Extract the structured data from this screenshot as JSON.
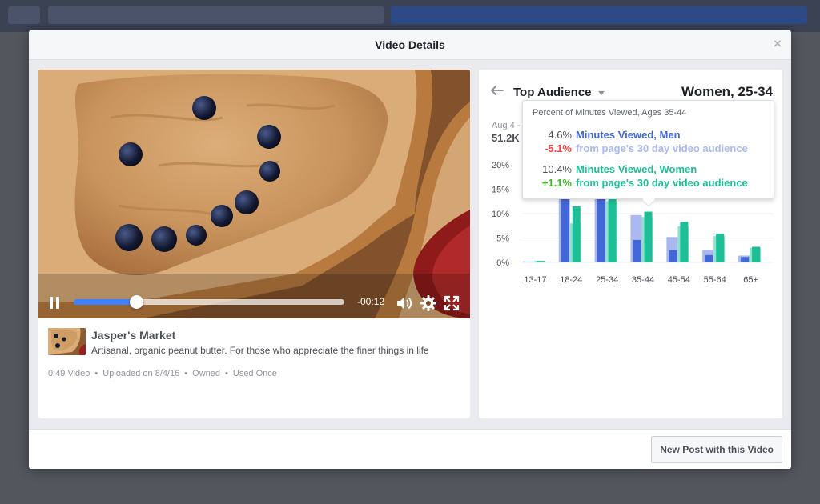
{
  "modal": {
    "title": "Video Details",
    "close_glyph": "×",
    "cta_label": "New Post with this Video"
  },
  "player": {
    "time_remaining": "-00:12",
    "progress": 0.23
  },
  "video_info": {
    "page_name": "Jasper's Market",
    "description": "Artisanal, organic peanut butter. For those who appreciate the finer things in life",
    "facts": [
      "0:49 Video",
      "Uploaded on 8/4/16",
      "Owned",
      "Used Once"
    ]
  },
  "audience": {
    "title": "Top Audience",
    "segment": "Women, 25-34",
    "date_label": "Aug 4 -",
    "big_number": "51.2K"
  },
  "tooltip": {
    "heading": "Percent of Minutes Viewed, Ages 35-44",
    "men_value": "4.6%",
    "men_label": "Minutes Viewed, Men",
    "men_delta": "-5.1%",
    "men_delta_label": "from page's 30 day video audience",
    "women_value": "10.4%",
    "women_label": "Minutes Viewed, Women",
    "women_delta": "+1.1%",
    "women_delta_label": "from page's 30 day video audience"
  },
  "colors": {
    "men": "#4267d6",
    "men_baseline": "#aab8ef",
    "women": "#1dbf97",
    "women_baseline": "#8fe3cb",
    "negative": "#fa3e3e",
    "positive": "#42b72a",
    "accent": "#4080ff"
  },
  "chart_data": {
    "type": "bar",
    "categories": [
      "13-17",
      "18-24",
      "25-34",
      "35-44",
      "45-54",
      "55-64",
      "65+"
    ],
    "series": [
      {
        "name": "Minutes Viewed, Men",
        "values": [
          0.1,
          14.5,
          14.0,
          4.6,
          2.5,
          1.5,
          1.1
        ]
      },
      {
        "name": "Minutes Viewed, Women",
        "values": [
          0.3,
          11.5,
          15.0,
          10.4,
          8.3,
          5.9,
          3.2
        ]
      }
    ],
    "baseline_series": [
      {
        "values": [
          0.2,
          13.0,
          13.5,
          9.7,
          5.2,
          2.6,
          1.4
        ]
      },
      {
        "values": [
          0.3,
          8.0,
          12.5,
          9.3,
          7.4,
          5.4,
          3.0
        ]
      }
    ],
    "yticks": [
      "0%",
      "5%",
      "10%",
      "15%",
      "20%"
    ],
    "ylim": [
      0,
      20
    ],
    "grid": true,
    "legend": "none"
  }
}
